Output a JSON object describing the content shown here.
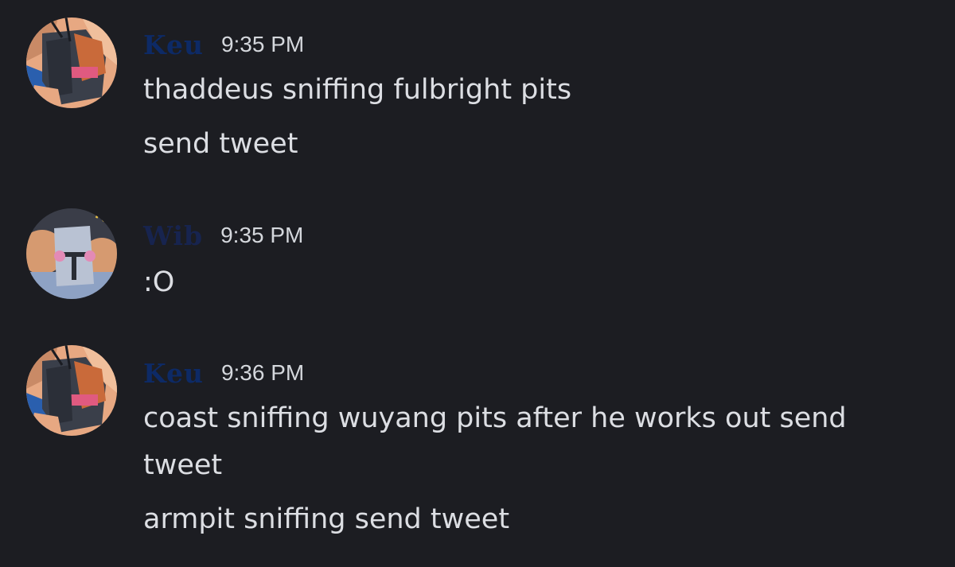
{
  "theme": {
    "background": "#1c1d22",
    "text": "#dcdee3",
    "timestamp": "#d4d7dc"
  },
  "groups": [
    {
      "username": "Keu",
      "username_color": "#0d2a66",
      "timestamp": "9:35 PM",
      "avatar": "knight-helmet-avatar",
      "lines": [
        "thaddeus sniffing fulbright pits",
        "send tweet"
      ]
    },
    {
      "username": "Wib",
      "username_color": "#17244f",
      "timestamp": "9:35 PM",
      "avatar": "blushing-knight-avatar",
      "lines": [
        ":O"
      ]
    },
    {
      "username": "Keu",
      "username_color": "#0d2a66",
      "timestamp": "9:36 PM",
      "avatar": "knight-helmet-avatar",
      "lines": [
        "coast sniffing wuyang pits after he works out send",
        "tweet",
        "armpit sniffing send tweet"
      ]
    }
  ]
}
